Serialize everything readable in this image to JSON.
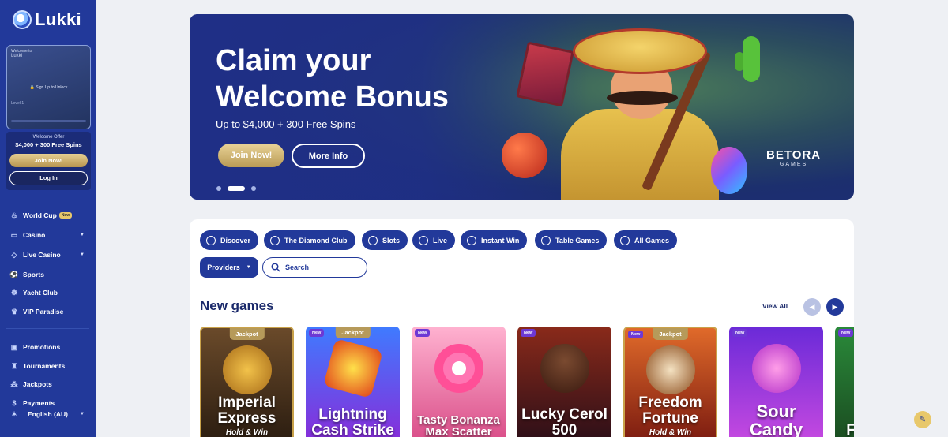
{
  "brand": {
    "name": "Lukki"
  },
  "profile": {
    "welcome": "Welcome to",
    "username": "Lukki",
    "lock_text": "Sign Up to Unlock",
    "level": "Level 1",
    "progress": 0
  },
  "offer": {
    "title": "Welcome Offer",
    "amount": "$4,000 + 300 Free Spins",
    "join": "Join Now!",
    "login": "Log In"
  },
  "nav": [
    {
      "label": "World Cup",
      "icon": "flame-icon",
      "badge": "New"
    },
    {
      "label": "Casino",
      "icon": "cards-icon",
      "dropdown": true
    },
    {
      "label": "Live Casino",
      "icon": "diamond-icon",
      "dropdown": true
    },
    {
      "label": "Sports",
      "icon": "ball-icon"
    },
    {
      "label": "Yacht Club",
      "icon": "wheel-icon"
    },
    {
      "label": "VIP Paradise",
      "icon": "crown-icon"
    },
    {
      "label": "Promotions",
      "icon": "gift-icon"
    },
    {
      "label": "Tournaments",
      "icon": "trophy-icon"
    },
    {
      "label": "Jackpots",
      "icon": "coins-icon"
    },
    {
      "label": "Payments",
      "icon": "money-icon"
    }
  ],
  "language": "English (AU)",
  "hero": {
    "line1": "Claim your",
    "line2": "Welcome Bonus",
    "sub": "Up to $4,000 + 300 Free Spins",
    "join": "Join Now!",
    "more": "More Info",
    "provider": "BETORA",
    "provider_sub": "GAMES",
    "slides": 3,
    "active_slide": 2
  },
  "chips": [
    "Discover",
    "The Diamond Club",
    "Slots",
    "Live",
    "Instant Win",
    "Table Games",
    "All Games"
  ],
  "filters": {
    "providers": "Providers",
    "search_placeholder": "Search"
  },
  "section": {
    "title": "New games",
    "view_all": "View All"
  },
  "games": [
    {
      "title": "Imperial Express",
      "tag": "Hold & Win",
      "badge": "Jackpot",
      "new": false
    },
    {
      "title": "Lightning Cash Strike",
      "tag": "",
      "badge": "Jackpot",
      "new": true
    },
    {
      "title": "Tasty Bonanza Max Scatter",
      "tag": "",
      "badge": "",
      "new": true
    },
    {
      "title": "Lucky Cerol 500",
      "tag": "",
      "badge": "",
      "new": true
    },
    {
      "title": "Freedom Fortune",
      "tag": "Hold & Win",
      "badge": "Jackpot",
      "new": true
    },
    {
      "title": "Sour Candy",
      "tag": "",
      "badge": "",
      "new": true
    },
    {
      "title": "F",
      "tag": "",
      "badge": "",
      "new": true
    }
  ],
  "badge_new": "New",
  "colors": {
    "primary": "#22399a",
    "gold": "#c9a24a",
    "background": "#eef0f4"
  }
}
